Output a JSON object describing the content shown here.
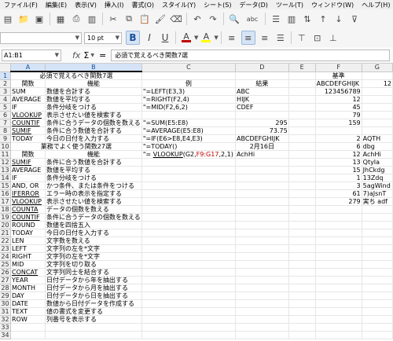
{
  "menu": [
    "ファイル(F)",
    "編集(E)",
    "表示(V)",
    "挿入(I)",
    "書式(O)",
    "スタイル(Y)",
    "シート(S)",
    "データ(D)",
    "ツール(T)",
    "ウィンドウ(W)",
    "ヘルプ(H)"
  ],
  "toolbar": {
    "font_size": "10 pt",
    "bold": "B",
    "italic": "I",
    "underline": "U",
    "font_color_letter": "A",
    "highlight_letter": "A",
    "spellcheck": "abc",
    "accent_color": "#1a4f9a",
    "font_color": "#c00000",
    "highlight_color": "#ffff00"
  },
  "formula_bar": {
    "name_box": "A1:B1",
    "fx": "fx",
    "sum": "Σ",
    "equals": "=",
    "content": "必須で覚えるべき関数7選"
  },
  "grid": {
    "columns": [
      "A",
      "B",
      "C",
      "D",
      "E",
      "F",
      "G"
    ],
    "rows": [
      {
        "n": "1",
        "A": "必須で覚えるべき関数7選",
        "C": "",
        "D": "",
        "E": "",
        "F": "基準",
        "G": ""
      },
      {
        "n": "2",
        "A": "関数",
        "B": "機能",
        "C": "例",
        "D": "結果",
        "E": "",
        "F": "ABCDEFGHIJK",
        "G": "12"
      },
      {
        "n": "3",
        "A": "SUM",
        "B": "数値を合計する",
        "C": "\"=LEFT(E3,3)",
        "D": "ABC",
        "E": "",
        "F": "123456789",
        "G": ""
      },
      {
        "n": "4",
        "A": "AVERAGE",
        "B": "数値を平均する",
        "C": "\"=RIGHT(F2,4)",
        "D": "HIJK",
        "E": "",
        "F": "12",
        "G": ""
      },
      {
        "n": "5",
        "A": "IF",
        "B": "条件分岐をつける",
        "C": "\"=MID(F2,6,2)",
        "D": "CDEF",
        "E": "",
        "F": "45",
        "G": ""
      },
      {
        "n": "6",
        "A": "VLOOKUP",
        "B": "表示させたい値を検索する",
        "C": "",
        "D": "",
        "E": "",
        "F": "79",
        "G": ""
      },
      {
        "n": "7",
        "A": "COUNTIF",
        "B": "条件に合うデータの個数を数える",
        "C": "\"=SUM(E5:E8)",
        "D": "295",
        "E": "",
        "F": "159",
        "G": ""
      },
      {
        "n": "8",
        "A": "SUMIF",
        "B": "条件に合う数値を合計する",
        "C": "\"=AVERAGE(E5:E8)",
        "D": "73.75",
        "E": "",
        "F": "",
        "G": ""
      },
      {
        "n": "9",
        "A": "TODAY",
        "B": "今日の日付を入力する",
        "C": "\"=IF(E6>E8,E4,E3)",
        "D": "ABCDEFGHIJK",
        "E": "",
        "F": "2",
        "G": "AQTH"
      },
      {
        "n": "10",
        "A": "業務でよく使う関数27選",
        "C": "\"=TODAY()",
        "D": "2月16日",
        "E": "",
        "F": "6",
        "G": "dbg"
      },
      {
        "n": "11",
        "A": "関数",
        "B": "機能",
        "C": "",
        "D": "AchHi",
        "E": "",
        "F": "12",
        "G": "AchHi"
      },
      {
        "n": "12",
        "A": "SUMIF",
        "B": "条件に合う数値を合計する",
        "C": "",
        "D": "",
        "E": "",
        "F": "13",
        "G": "QtyIa"
      },
      {
        "n": "13",
        "A": "AVERAGE",
        "B": "数値を平均する",
        "C": "",
        "D": "",
        "E": "",
        "F": "15",
        "G": "JhCkdg"
      },
      {
        "n": "14",
        "A": "IF",
        "B": "条件分岐をつける",
        "C": "",
        "D": "",
        "E": "",
        "F": "1",
        "G": "13Zdq"
      },
      {
        "n": "15",
        "A": "AND, OR",
        "B": "かつ条件、または条件をつける",
        "C": "",
        "D": "",
        "E": "",
        "F": "3",
        "G": "5agWind"
      },
      {
        "n": "16",
        "A": "IFERROR",
        "B": "エラー時の表示を指定する",
        "C": "",
        "D": "",
        "E": "",
        "F": "61",
        "G": "7)aJsnT"
      },
      {
        "n": "17",
        "A": "VLOOKUP",
        "B": "表示させたい値を検索する",
        "C": "",
        "D": "",
        "E": "",
        "F": "279",
        "G": "実ち adf"
      },
      {
        "n": "18",
        "A": "COUNTA",
        "B": "データの個数を数える",
        "C": "",
        "D": "",
        "E": "",
        "F": "",
        "G": ""
      },
      {
        "n": "19",
        "A": "COUNTIF",
        "B": "条件に合うデータの個数を数える",
        "C": "",
        "D": "",
        "E": "",
        "F": "",
        "G": ""
      },
      {
        "n": "20",
        "A": "ROUND",
        "B": "数値を四捨五入",
        "C": "",
        "D": "",
        "E": "",
        "F": "",
        "G": ""
      },
      {
        "n": "21",
        "A": "TODAY",
        "B": "今日の日付を入力する",
        "C": "",
        "D": "",
        "E": "",
        "F": "",
        "G": ""
      },
      {
        "n": "22",
        "A": "LEN",
        "B": "文字数を数える",
        "C": "",
        "D": "",
        "E": "",
        "F": "",
        "G": ""
      },
      {
        "n": "23",
        "A": "LEFT",
        "B": "文字列の左を*文字",
        "C": "",
        "D": "",
        "E": "",
        "F": "",
        "G": ""
      },
      {
        "n": "24",
        "A": "RIGHT",
        "B": "文字列の左を*文字",
        "C": "",
        "D": "",
        "E": "",
        "F": "",
        "G": ""
      },
      {
        "n": "25",
        "A": "MID",
        "B": "文字列を切り取る",
        "C": "",
        "D": "",
        "E": "",
        "F": "",
        "G": ""
      },
      {
        "n": "26",
        "A": "CONCAT",
        "B": "文字列同士を結合する",
        "C": "",
        "D": "",
        "E": "",
        "F": "",
        "G": ""
      },
      {
        "n": "27",
        "A": "YEAR",
        "B": "日付データから年を抽出する",
        "C": "",
        "D": "",
        "E": "",
        "F": "",
        "G": ""
      },
      {
        "n": "28",
        "A": "MONTH",
        "B": "日付データから月を抽出する",
        "C": "",
        "D": "",
        "E": "",
        "F": "",
        "G": ""
      },
      {
        "n": "29",
        "A": "DAY",
        "B": "日付データから日を抽出する",
        "C": "",
        "D": "",
        "E": "",
        "F": "",
        "G": ""
      },
      {
        "n": "30",
        "A": "DATE",
        "B": "数値から日付データを作成する",
        "C": "",
        "D": "",
        "E": "",
        "F": "",
        "G": ""
      },
      {
        "n": "31",
        "A": "TEXT",
        "B": "値の書式を変更する",
        "C": "",
        "D": "",
        "E": "",
        "F": "",
        "G": ""
      },
      {
        "n": "32",
        "A": "ROW",
        "B": "列番号を表示する",
        "C": "",
        "D": "",
        "E": "",
        "F": "",
        "G": ""
      },
      {
        "n": "33",
        "A": "",
        "B": "",
        "C": "",
        "D": "",
        "E": "",
        "F": "",
        "G": ""
      },
      {
        "n": "34",
        "A": "",
        "B": "",
        "C": "",
        "D": "",
        "E": "",
        "F": "",
        "G": ""
      }
    ],
    "vlookup_formula": {
      "prefix": "\"= ",
      "fn": "VLOOKUP",
      "open": "(",
      "arg1": "G2,",
      "arg2": "F9:G17",
      "rest": ",2,1)"
    }
  }
}
